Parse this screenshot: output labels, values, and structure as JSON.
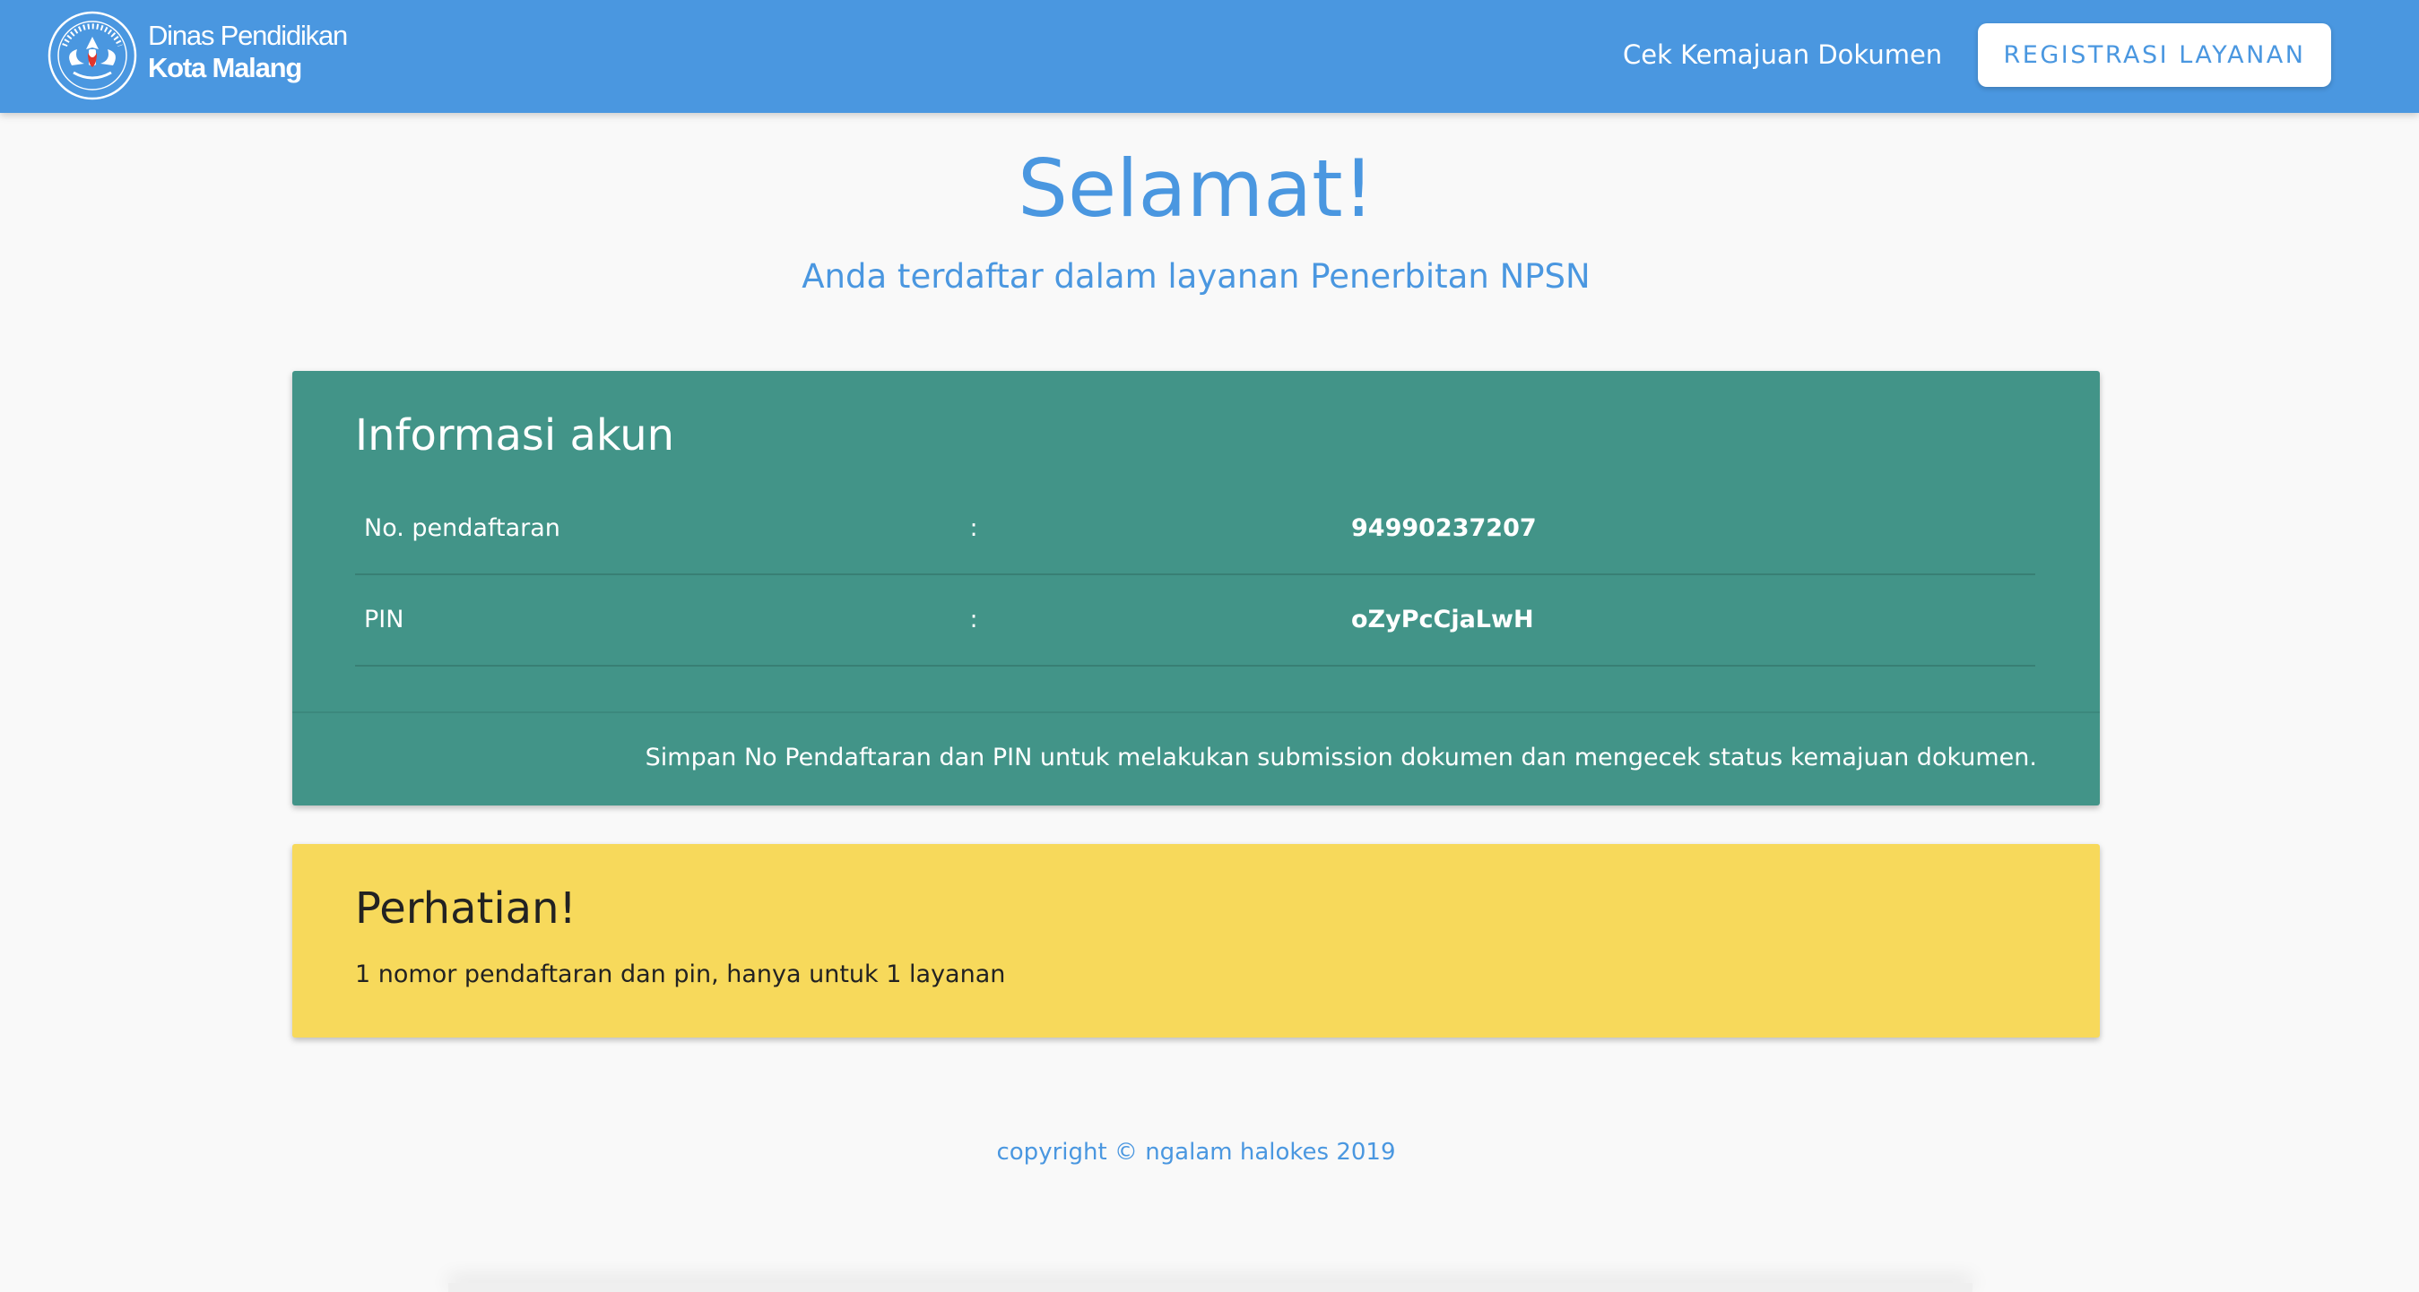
{
  "navbar": {
    "brand_line1": "Dinas Pendidikan",
    "brand_line2": "Kota Malang",
    "logo_icon": "tut-wuri-handayani-logo",
    "link_label": "Cek Kemajuan Dokumen",
    "button_label": "REGISTRASI LAYANAN"
  },
  "hero": {
    "title": "Selamat!",
    "subtitle": "Anda terdaftar dalam layanan Penerbitan NPSN"
  },
  "info_card": {
    "title": "Informasi akun",
    "rows": [
      {
        "label": "No. pendaftaran",
        "separator": ":",
        "value": "94990237207"
      },
      {
        "label": "PIN",
        "separator": ":",
        "value": "oZyPcCjaLwH"
      }
    ],
    "note": "Simpan No Pendaftaran dan PIN untuk melakukan submission dokumen dan mengecek status kemajuan dokumen."
  },
  "warning_card": {
    "title": "Perhatian!",
    "text": "1 nomor pendaftaran dan pin, hanya untuk 1 layanan"
  },
  "footer": {
    "copyright": "copyright © ngalam halokes 2019"
  },
  "colors": {
    "primary": "#4a97e0",
    "info_card_bg": "#429488",
    "warning_card_bg": "#f7d95b",
    "page_bg": "#f9f9f9"
  }
}
